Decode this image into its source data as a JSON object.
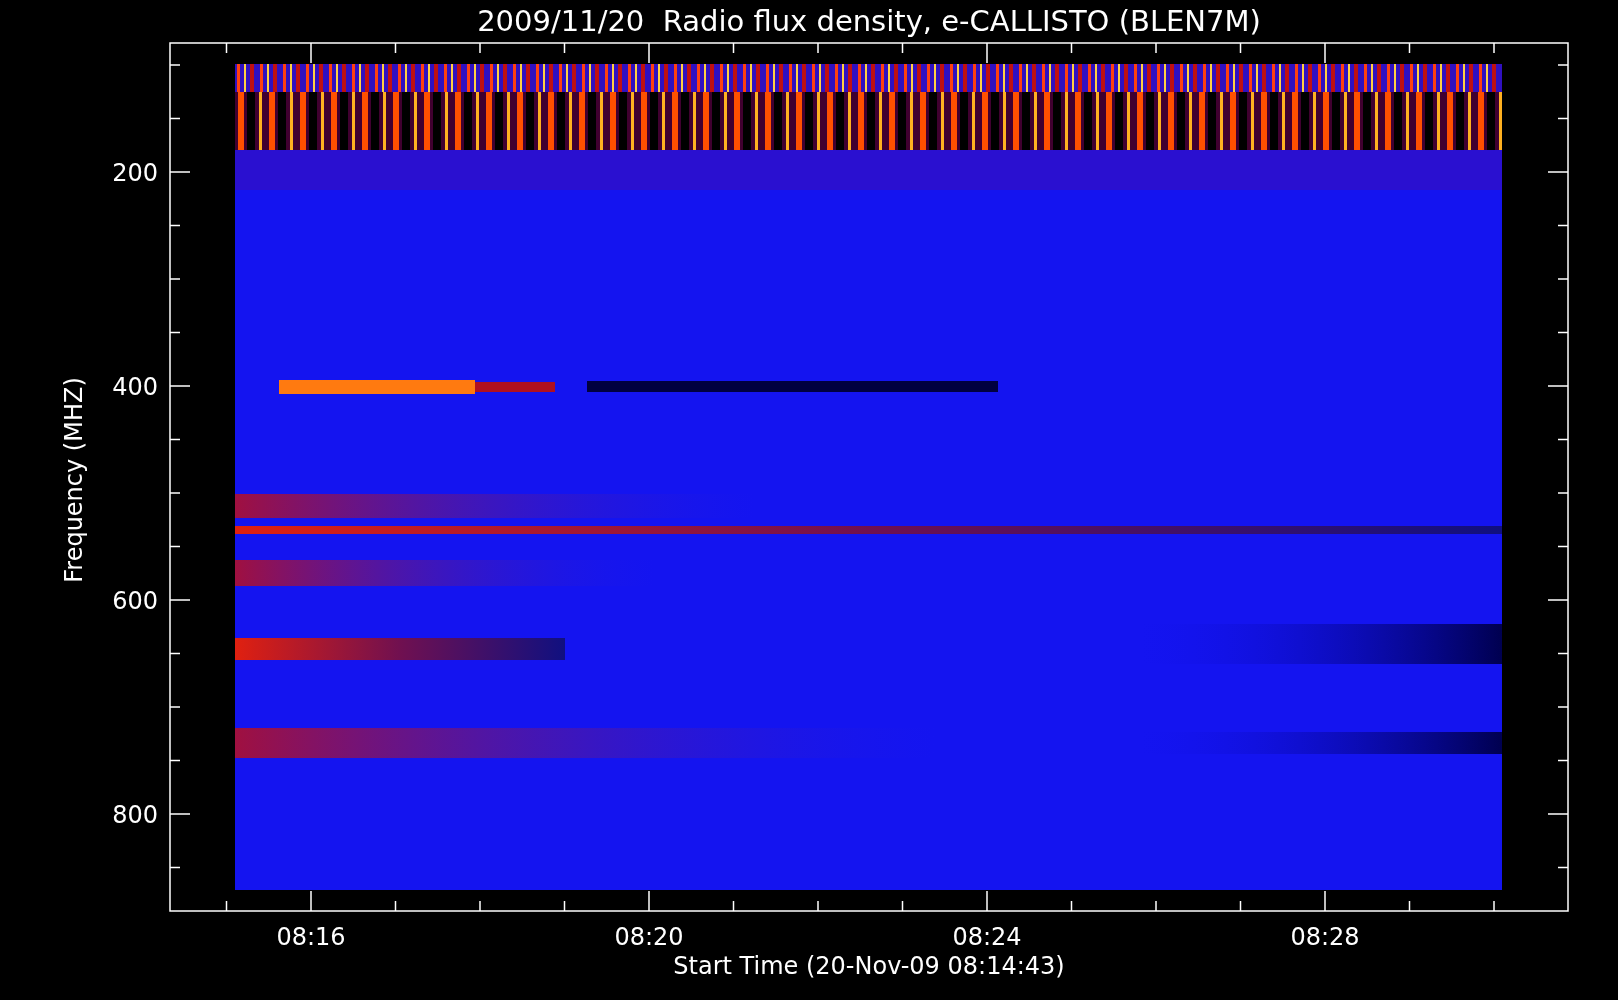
{
  "title": "2009/11/20  Radio flux density, e-CALLISTO (BLEN7M)",
  "y_axis": {
    "label": "Frequency (MHZ)",
    "ticks": [
      "200",
      "400",
      "600",
      "800"
    ]
  },
  "x_axis": {
    "label": "Start Time (20-Nov-09 08:14:43)",
    "ticks": [
      "08:16",
      "08:20",
      "08:24",
      "08:28"
    ]
  }
}
